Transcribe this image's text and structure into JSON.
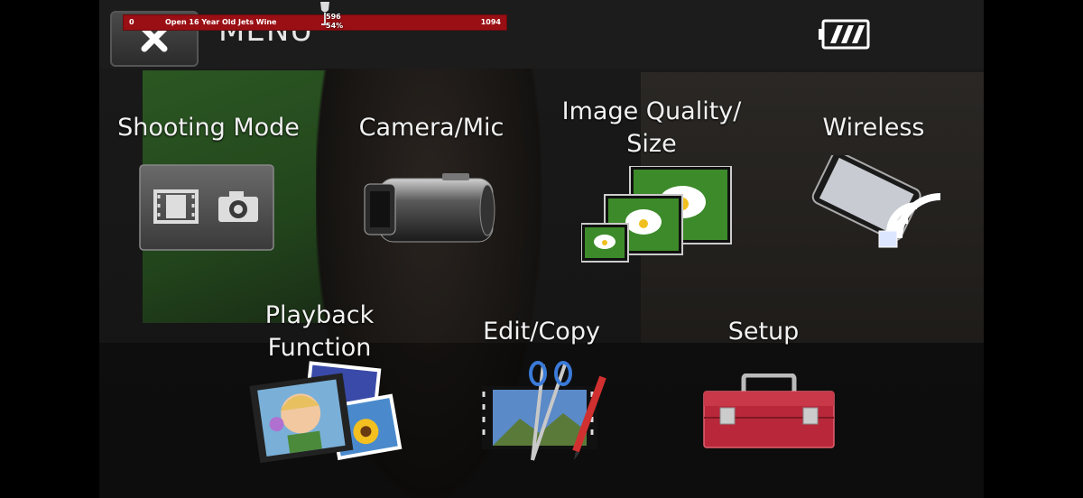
{
  "header": {
    "title": "MENU",
    "close_icon": "close-icon",
    "battery_icon": "battery-icon"
  },
  "overlay": {
    "left_value": "0",
    "title": "Open 16 Year Old Jets Wine",
    "top_value": "596",
    "percent": "54%",
    "right_value": "1094",
    "color": "#9a0f14"
  },
  "menu": {
    "items": [
      {
        "label": "Shooting Mode",
        "icon": "shooting-mode-icon"
      },
      {
        "label": "Camera/Mic",
        "icon": "camcorder-icon"
      },
      {
        "label_lines": [
          "Image Quality/",
          "Size"
        ],
        "icon": "image-quality-icon"
      },
      {
        "label": "Wireless",
        "icon": "wireless-icon"
      },
      {
        "label_lines": [
          "Playback",
          "Function"
        ],
        "icon": "playback-photos-icon"
      },
      {
        "label": "Edit/Copy",
        "icon": "edit-copy-icon"
      },
      {
        "label": "Setup",
        "icon": "toolbox-icon"
      }
    ]
  }
}
